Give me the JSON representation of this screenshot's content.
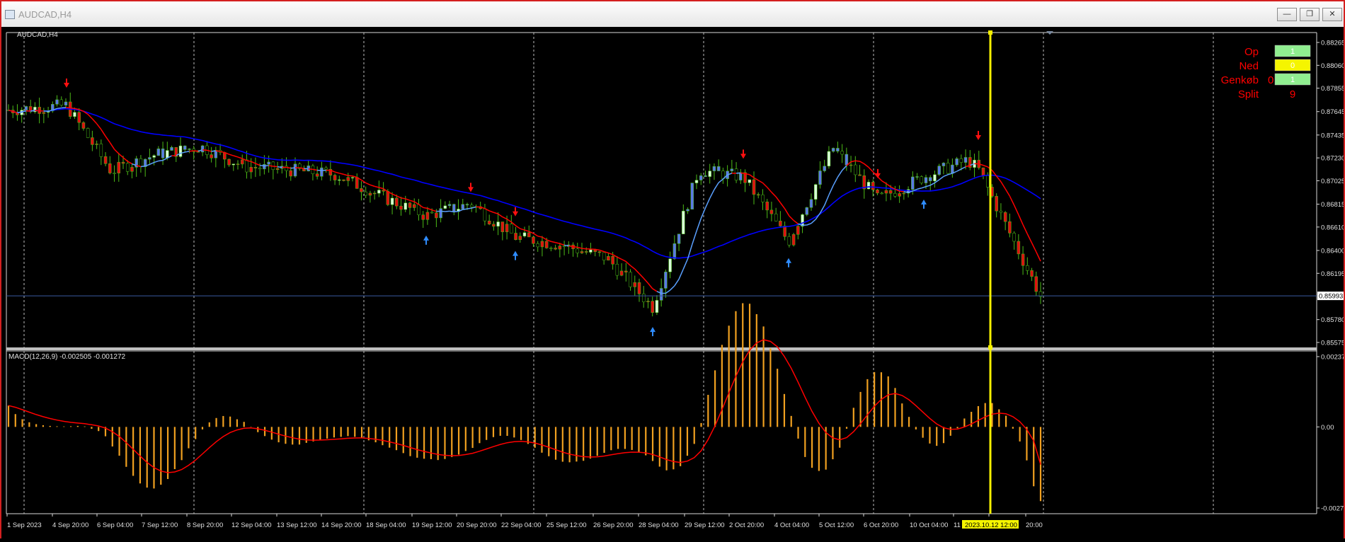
{
  "window": {
    "title": "AUDCAD,H4",
    "buttons": [
      "minimize",
      "restore",
      "close"
    ]
  },
  "chart_header": {
    "symbol_label": "AUDCAD,H4"
  },
  "panel": {
    "rows": [
      {
        "label": "Op",
        "value": "1",
        "prefix": "",
        "color": "#90ee90"
      },
      {
        "label": "Ned",
        "value": "0",
        "prefix": "",
        "color": "#f5f500"
      },
      {
        "label": "Genkøb",
        "value": "1",
        "prefix": "0",
        "color": "#90ee90"
      },
      {
        "label": "Split",
        "value": "9",
        "prefix": "",
        "color": null
      }
    ],
    "label_color": "#ff0000"
  },
  "macd_label": "MACD(12,26,9) -0.002505 -0.001272",
  "price_axis": {
    "ticks": [
      "0.88265",
      "0.88060",
      "0.87855",
      "0.87645",
      "0.87435",
      "0.87230",
      "0.87025",
      "0.86815",
      "0.86610",
      "0.86400",
      "0.86195",
      "0.85780",
      "0.85575"
    ],
    "current_price": "0.85993"
  },
  "macd_axis": {
    "ticks": [
      "0.002371",
      "0.00",
      "-0.002737"
    ]
  },
  "time_axis": {
    "labels": [
      "1 Sep 2023",
      "4 Sep 20:00",
      "6 Sep 04:00",
      "7 Sep 12:00",
      "8 Sep 20:00",
      "12 Sep 04:00",
      "13 Sep 12:00",
      "14 Sep 20:00",
      "18 Sep 04:00",
      "19 Sep 12:00",
      "20 Sep 20:00",
      "22 Sep 04:00",
      "25 Sep 12:00",
      "26 Sep 20:00",
      "28 Sep 04:00",
      "29 Sep 12:00",
      "2 Oct 20:00",
      "4 Oct 04:00",
      "5 Oct 12:00",
      "6 Oct 20:00",
      "10 Oct 04:00",
      "11",
      "2023.10.12 12:00",
      "20:00"
    ]
  },
  "chart_data": {
    "type": "line",
    "symbol": "AUDCAD",
    "timeframe": "H4",
    "x_range": [
      "1 Sep 2023",
      "13 Oct 2023"
    ],
    "price_ylim": [
      0.85575,
      0.88265
    ],
    "close_series": [
      {
        "x": "1 Sep 2023",
        "y": 0.8766
      },
      {
        "x": "4 Sep 20:00",
        "y": 0.877
      },
      {
        "x": "6 Sep 04:00",
        "y": 0.8711
      },
      {
        "x": "7 Sep 12:00",
        "y": 0.8726
      },
      {
        "x": "8 Sep 20:00",
        "y": 0.8733
      },
      {
        "x": "12 Sep 04:00",
        "y": 0.8715
      },
      {
        "x": "13 Sep 12:00",
        "y": 0.8712
      },
      {
        "x": "14 Sep 20:00",
        "y": 0.8708
      },
      {
        "x": "18 Sep 04:00",
        "y": 0.8689
      },
      {
        "x": "19 Sep 12:00",
        "y": 0.8671
      },
      {
        "x": "20 Sep 20:00",
        "y": 0.8682
      },
      {
        "x": "22 Sep 04:00",
        "y": 0.8652
      },
      {
        "x": "25 Sep 12:00",
        "y": 0.8645
      },
      {
        "x": "26 Sep 20:00",
        "y": 0.8633
      },
      {
        "x": "28 Sep 04:00",
        "y": 0.8589
      },
      {
        "x": "29 Sep 12:00",
        "y": 0.8712
      },
      {
        "x": "2 Oct 20:00",
        "y": 0.8706
      },
      {
        "x": "4 Oct 04:00",
        "y": 0.8648
      },
      {
        "x": "5 Oct 12:00",
        "y": 0.8732
      },
      {
        "x": "6 Oct 20:00",
        "y": 0.8686
      },
      {
        "x": "10 Oct 04:00",
        "y": 0.8706
      },
      {
        "x": "11 Oct",
        "y": 0.8721
      },
      {
        "x": "2023.10.12 12:00",
        "y": 0.8713
      },
      {
        "x": "20:00",
        "y": 0.8599
      }
    ],
    "moving_average_color": "#0000ff",
    "signal_line_colors": {
      "up": "#5aa0ff",
      "down": "#ff0000"
    },
    "arrows": {
      "down": [
        "4 Sep 20:00",
        "20 Sep 20:00",
        "22 Sep 04:00",
        "2 Oct 20:00",
        "6 Oct 20:00",
        "2023.10.12 12:00"
      ],
      "up": [
        "19 Sep 12:00",
        "22 Sep 04:00",
        "28 Sep 04:00",
        "4 Oct 04:00",
        "10 Oct 04:00"
      ]
    },
    "current_price": 0.85993,
    "vertical_marker": "2023.10.12 12:00",
    "macd": {
      "params": "12,26,9",
      "main": -0.002505,
      "signal": -0.001272,
      "ylim": [
        -0.002737,
        0.002371
      ],
      "histogram_color": "#f0a020",
      "signal_color": "#ff0000"
    },
    "grid": true
  }
}
